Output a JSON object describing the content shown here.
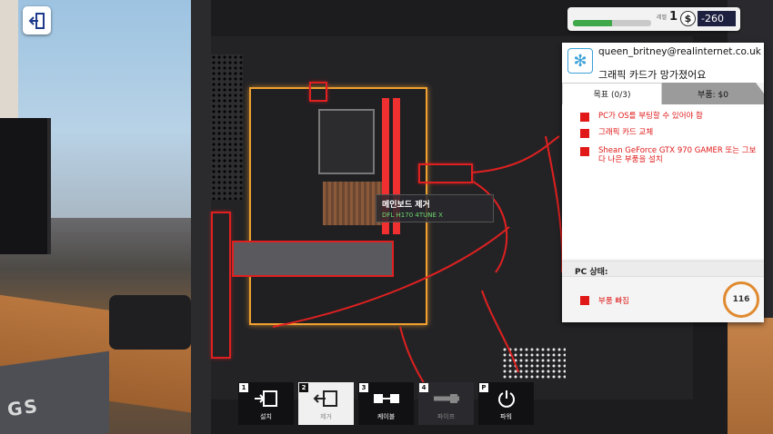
{
  "hud": {
    "level_label": "레벨",
    "level": "1",
    "currency_symbol": "$",
    "money": "-260",
    "xp_fraction": 0.5
  },
  "job": {
    "client_email": "queen_britney@realinternet.co.uk",
    "client_message": "그래픽 카드가 망가졌어요",
    "tabs": {
      "goals": "목표 (0/3)",
      "parts": "부품: $0"
    },
    "goals": [
      "PC가 OS를 부팅할 수 있어야 함",
      "그래픽 카드 교체",
      "Shean GeForce GTX 970 GAMER 또는 그보다 나은 부품을 설치"
    ],
    "pc_status_title": "PC 상태:",
    "pc_status": "부품 빠짐",
    "timer": "116"
  },
  "tooltip": {
    "title": "메인보드 제거",
    "part": "DFL H170 4TUNE X"
  },
  "toolbar": [
    {
      "key": "1",
      "label": "설치",
      "icon": "install-icon",
      "state": "normal"
    },
    {
      "key": "2",
      "label": "제거",
      "icon": "remove-icon",
      "state": "active"
    },
    {
      "key": "3",
      "label": "케이블",
      "icon": "cable-icon",
      "state": "normal"
    },
    {
      "key": "4",
      "label": "파이프",
      "icon": "pipe-icon",
      "state": "disabled"
    },
    {
      "key": "P",
      "label": "파워",
      "icon": "power-icon",
      "state": "normal"
    }
  ],
  "scene": {
    "mousepad_logo": "GS"
  },
  "colors": {
    "goal_red": "#e01818",
    "highlight_orange": "#f0a030",
    "money_bg": "#1e2040",
    "xp_green": "#3fa84a"
  }
}
